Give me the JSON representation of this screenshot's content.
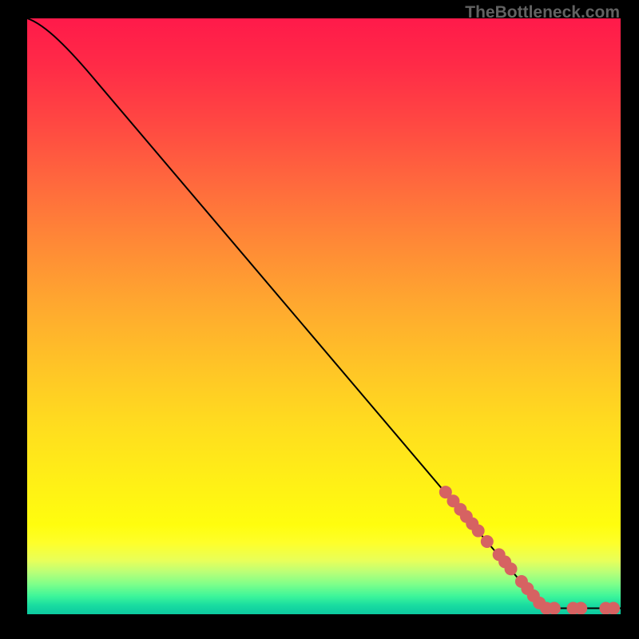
{
  "watermark": "TheBottleneck.com",
  "chart_data": {
    "type": "line",
    "title": "",
    "xlabel": "",
    "ylabel": "",
    "xlim": [
      0,
      100
    ],
    "ylim": [
      0,
      100
    ],
    "curve": [
      {
        "x": 0,
        "y": 100
      },
      {
        "x": 4,
        "y": 97
      },
      {
        "x": 8,
        "y": 93.5
      },
      {
        "x": 12,
        "y": 89
      },
      {
        "x": 87,
        "y": 1
      },
      {
        "x": 100,
        "y": 1
      }
    ],
    "points": [
      {
        "x": 70.5,
        "y": 20.5
      },
      {
        "x": 71.8,
        "y": 19.0
      },
      {
        "x": 73.0,
        "y": 17.6
      },
      {
        "x": 74.0,
        "y": 16.4
      },
      {
        "x": 75.0,
        "y": 15.2
      },
      {
        "x": 76.0,
        "y": 14.0
      },
      {
        "x": 77.5,
        "y": 12.2
      },
      {
        "x": 79.5,
        "y": 10.0
      },
      {
        "x": 80.5,
        "y": 8.8
      },
      {
        "x": 81.5,
        "y": 7.6
      },
      {
        "x": 83.3,
        "y": 5.5
      },
      {
        "x": 84.3,
        "y": 4.3
      },
      {
        "x": 85.3,
        "y": 3.1
      },
      {
        "x": 86.3,
        "y": 1.9
      },
      {
        "x": 87.5,
        "y": 1.0
      },
      {
        "x": 88.8,
        "y": 1.0
      },
      {
        "x": 92.0,
        "y": 1.0
      },
      {
        "x": 93.3,
        "y": 1.0
      },
      {
        "x": 97.5,
        "y": 1.0
      },
      {
        "x": 98.8,
        "y": 1.0
      }
    ],
    "point_color": "#d66262",
    "point_radius_px": 8
  }
}
